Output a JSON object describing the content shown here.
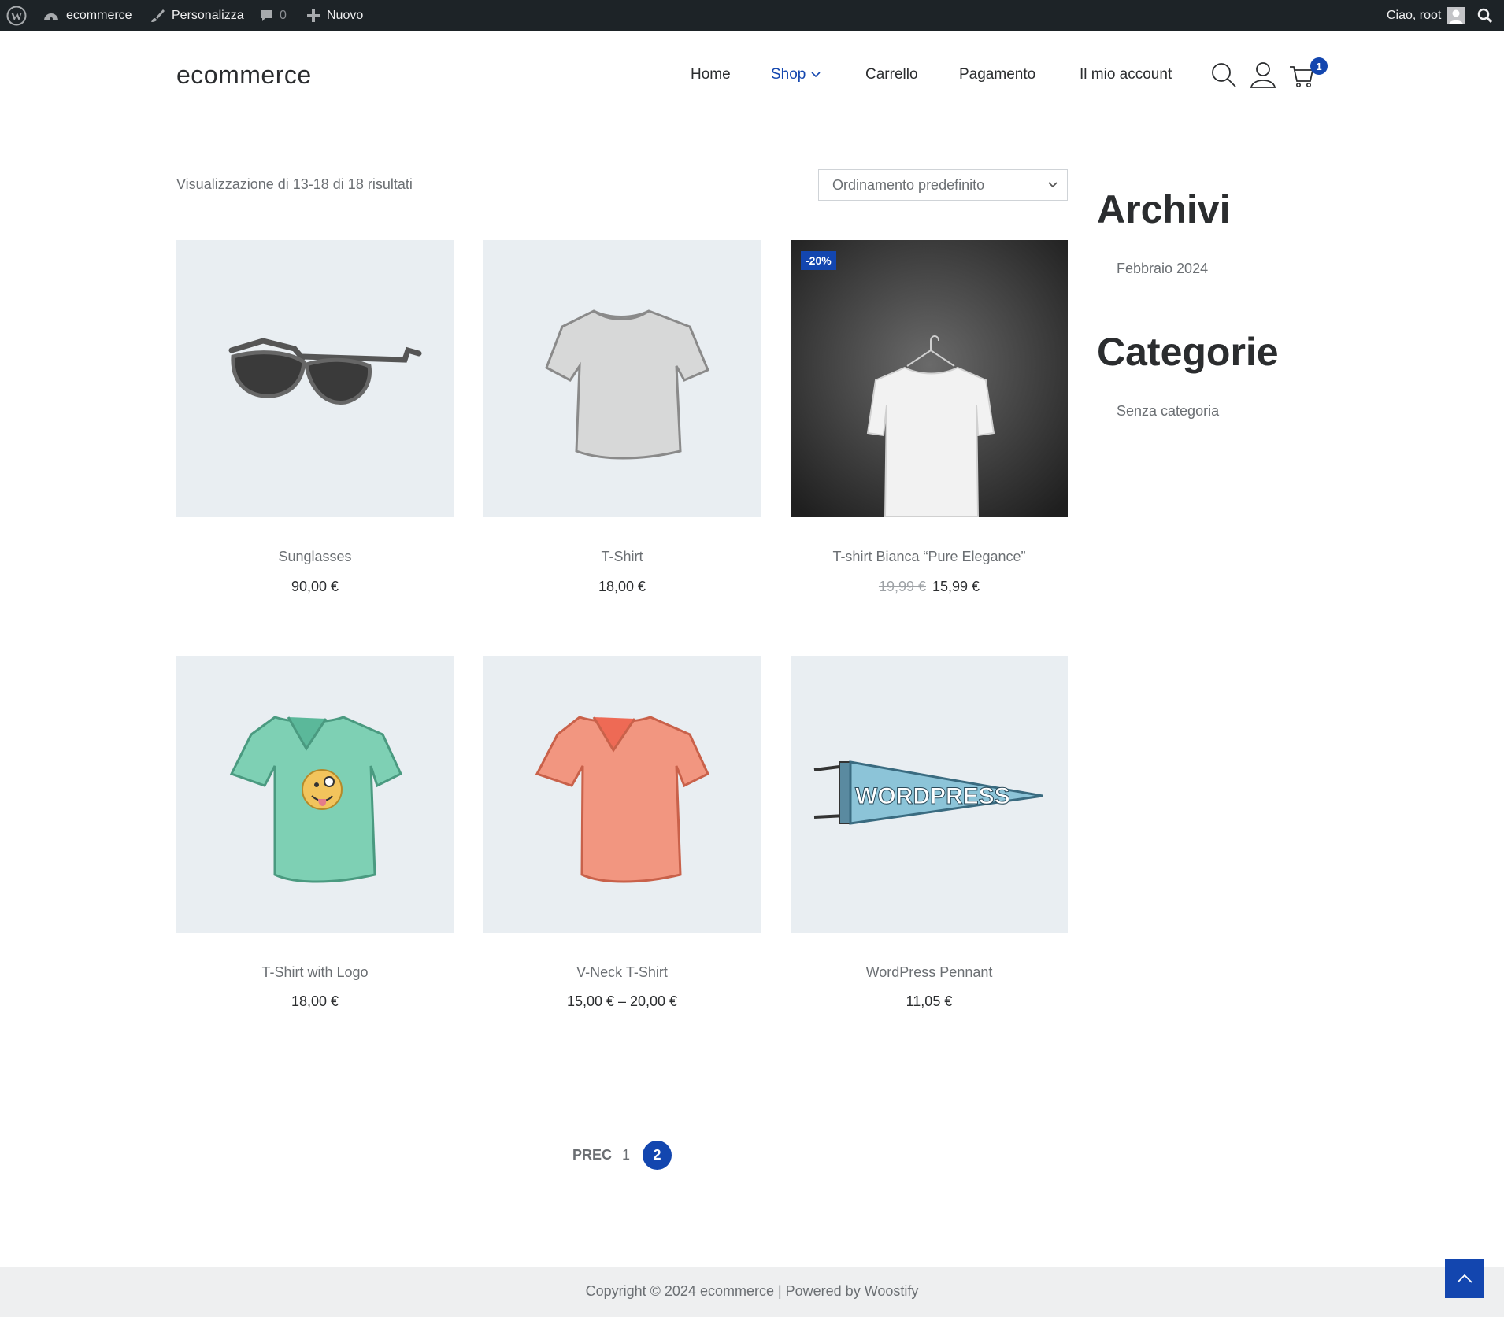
{
  "adminbar": {
    "site": "ecommerce",
    "customize": "Personalizza",
    "comments_count": "0",
    "new": "Nuovo",
    "greeting": "Ciao, root"
  },
  "header": {
    "logo": "ecommerce",
    "nav": [
      "Home",
      "Shop",
      "Carrello",
      "Pagamento",
      "Il mio account"
    ],
    "active_nav": "Shop",
    "cart_count": "1"
  },
  "shop": {
    "result_count": "Visualizzazione di 13-18 di 18 risultati",
    "ordering": "Ordinamento predefinito"
  },
  "products": [
    {
      "title": "Sunglasses",
      "price": "90,00 €",
      "image": "sunglasses"
    },
    {
      "title": "T-Shirt",
      "price": "18,00 €",
      "image": "grey-tshirt"
    },
    {
      "title": "T-shirt Bianca “Pure Elegance”",
      "old_price": "19,99 €",
      "price": "15,99 €",
      "badge": "-20%",
      "image": "white-tshirt-photo"
    },
    {
      "title": "T-Shirt with Logo",
      "price": "18,00 €",
      "image": "green-tshirt-logo"
    },
    {
      "title": "V-Neck T-Shirt",
      "price": "15,00 € – 20,00 €",
      "image": "red-vneck"
    },
    {
      "title": "WordPress Pennant",
      "price": "11,05 €",
      "image": "pennant"
    }
  ],
  "sidebar": {
    "archives_title": "Archivi",
    "archives": [
      "Febbraio 2024"
    ],
    "categories_title": "Categorie",
    "categories": [
      "Senza categoria"
    ]
  },
  "pagination": {
    "prev": "PREC",
    "pages": [
      "1",
      "2"
    ],
    "current": "2"
  },
  "footer": {
    "text": "Copyright © 2024 ecommerce | Powered by Woostify"
  },
  "pennant_text": "WORDPRESS",
  "colors": {
    "accent": "#1346af",
    "adminbar": "#1d2327",
    "product_bg": "#e9eef2"
  }
}
